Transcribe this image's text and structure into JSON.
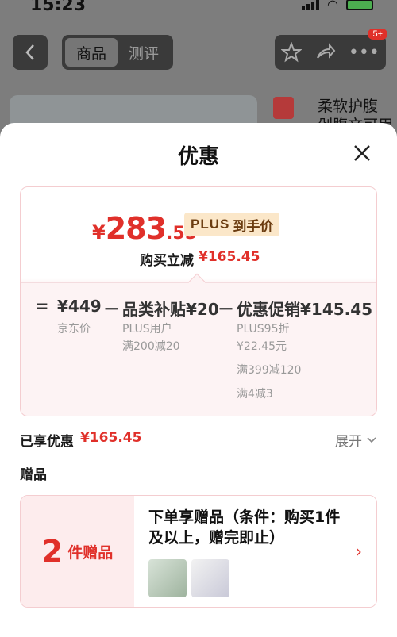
{
  "status_bar": {
    "time": "15:23"
  },
  "nav": {
    "tabs": [
      {
        "label": "商品",
        "active": true
      },
      {
        "label": "测评",
        "active": false
      }
    ],
    "badge": "5+"
  },
  "background": {
    "product_text_line1": "柔软护腹",
    "product_text_line2": "剁腹文可用"
  },
  "sheet": {
    "title": "优惠",
    "price_card": {
      "final_price_symbol": "¥",
      "final_price_int": "283",
      "final_price_dec": ".55",
      "plus_tag": {
        "label": "PLUS",
        "suffix": "到手价"
      },
      "discount_label": "购买立减",
      "discount_amount": "¥165.45",
      "calc": {
        "equals": "=",
        "base": {
          "value": "¥449",
          "label": "京东价"
        },
        "minus1": "－",
        "subsidy": {
          "value": "品类补贴¥20",
          "lines": [
            "PLUS用户",
            "满200减20"
          ]
        },
        "minus2": "－",
        "promo": {
          "value": "优惠促销¥145.45",
          "lines": [
            "PLUS95折",
            "¥22.45元",
            "满399减120",
            "满4减3"
          ]
        }
      }
    },
    "enjoyed": {
      "label": "已享优惠",
      "amount": "¥165.45"
    },
    "expand_label": "展开",
    "gifts": {
      "title": "赠品",
      "count": "2",
      "count_label": "件赠品",
      "description": "下单享赠品（条件：购买1件及以上，赠完即止）"
    }
  },
  "colors": {
    "accent": "#e0302a",
    "plus_tag_bg": "#fbe7c9",
    "card_border": "#f4cdd0"
  }
}
